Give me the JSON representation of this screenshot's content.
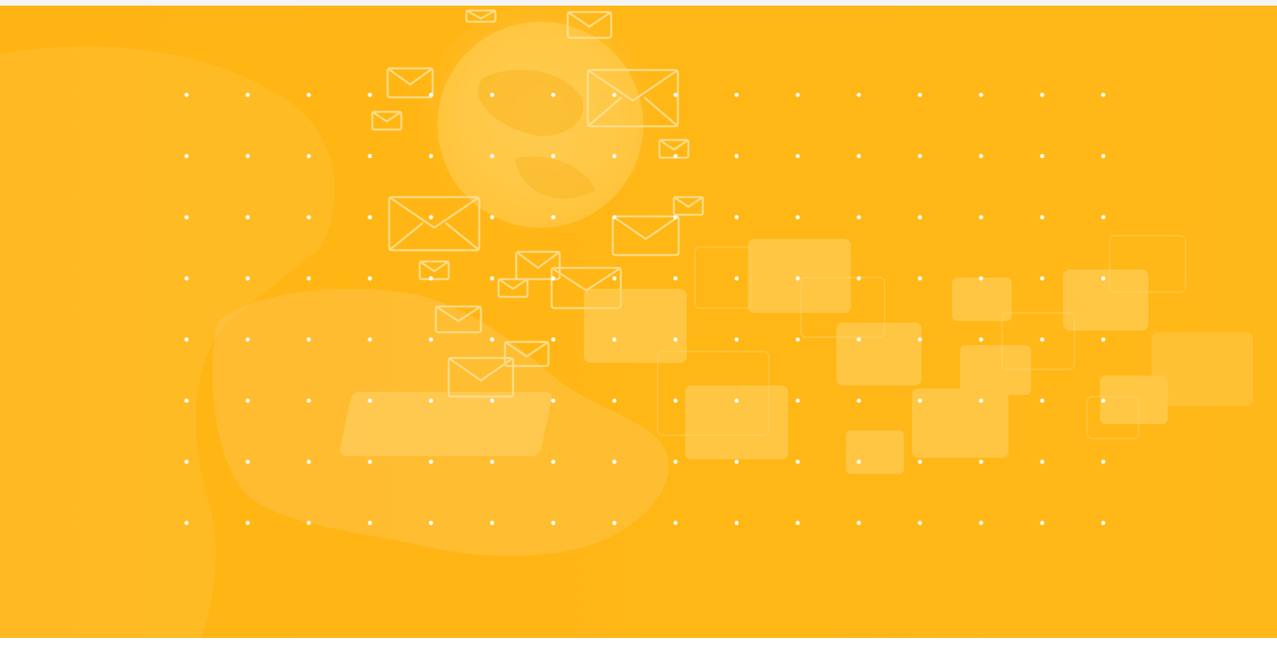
{
  "hero": {
    "background_color": "#FFB413",
    "overlay_color": "#FFC84A",
    "dot_color": "#FFFFFF",
    "icons": [
      "globe-icon",
      "envelope-icon",
      "smartphone-icon",
      "hand-icon"
    ]
  }
}
